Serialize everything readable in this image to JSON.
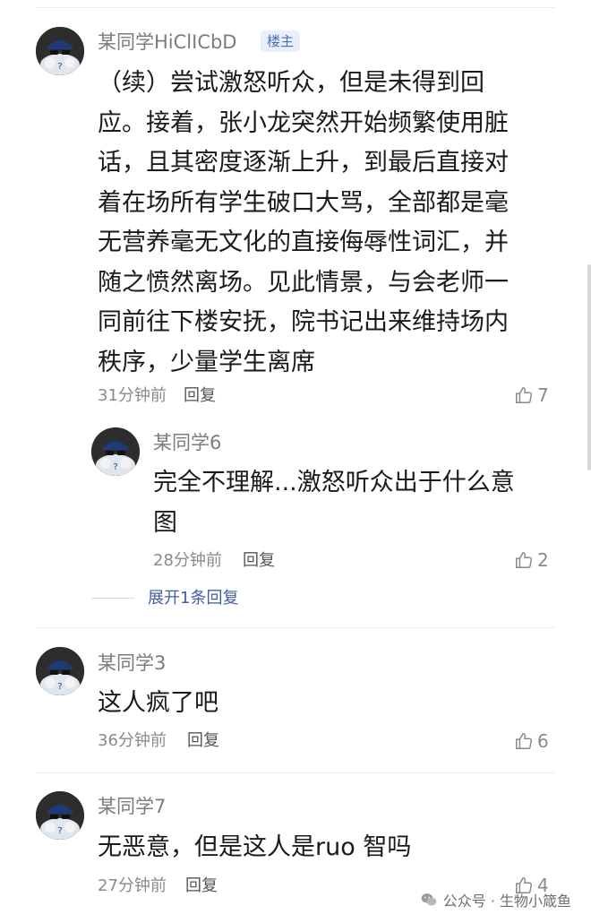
{
  "comments": [
    {
      "name": "某同学HiClICbD",
      "badge": "楼主",
      "content": "（续）尝试激怒听众，但是未得到回\n应。接着，张小龙突然开始频繁使用脏\n话，且其密度逐渐上升，到最后直接对\n着在场所有学生破口大骂，全部都是毫\n无营养毫无文化的直接侮辱性词汇，并\n随之愤然离场。见此情景，与会老师一\n同前往下楼安抚，院书记出来维持场内\n秩序，少量学生离席",
      "time": "31分钟前",
      "reply": "回复",
      "likes": "7",
      "replies": [
        {
          "name": "某同学6",
          "content": "完全不理解...激怒听众出于什么意\n图",
          "time": "28分钟前",
          "reply": "回复",
          "likes": "2"
        }
      ],
      "expand": "展开1条回复"
    },
    {
      "name": "某同学3",
      "content": "这人疯了吧",
      "time": "36分钟前",
      "reply": "回复",
      "likes": "6"
    },
    {
      "name": "某同学7",
      "content": "无恶意，但是这人是ruo 智吗",
      "time": "27分钟前",
      "reply": "回复",
      "likes": "4"
    }
  ],
  "watermark": {
    "icon": "wechat-icon",
    "label": "公众号 · 生物小箴鱼"
  },
  "icons": {
    "avatar": "user-avatar-icon",
    "like": "thumbs-up-icon"
  }
}
